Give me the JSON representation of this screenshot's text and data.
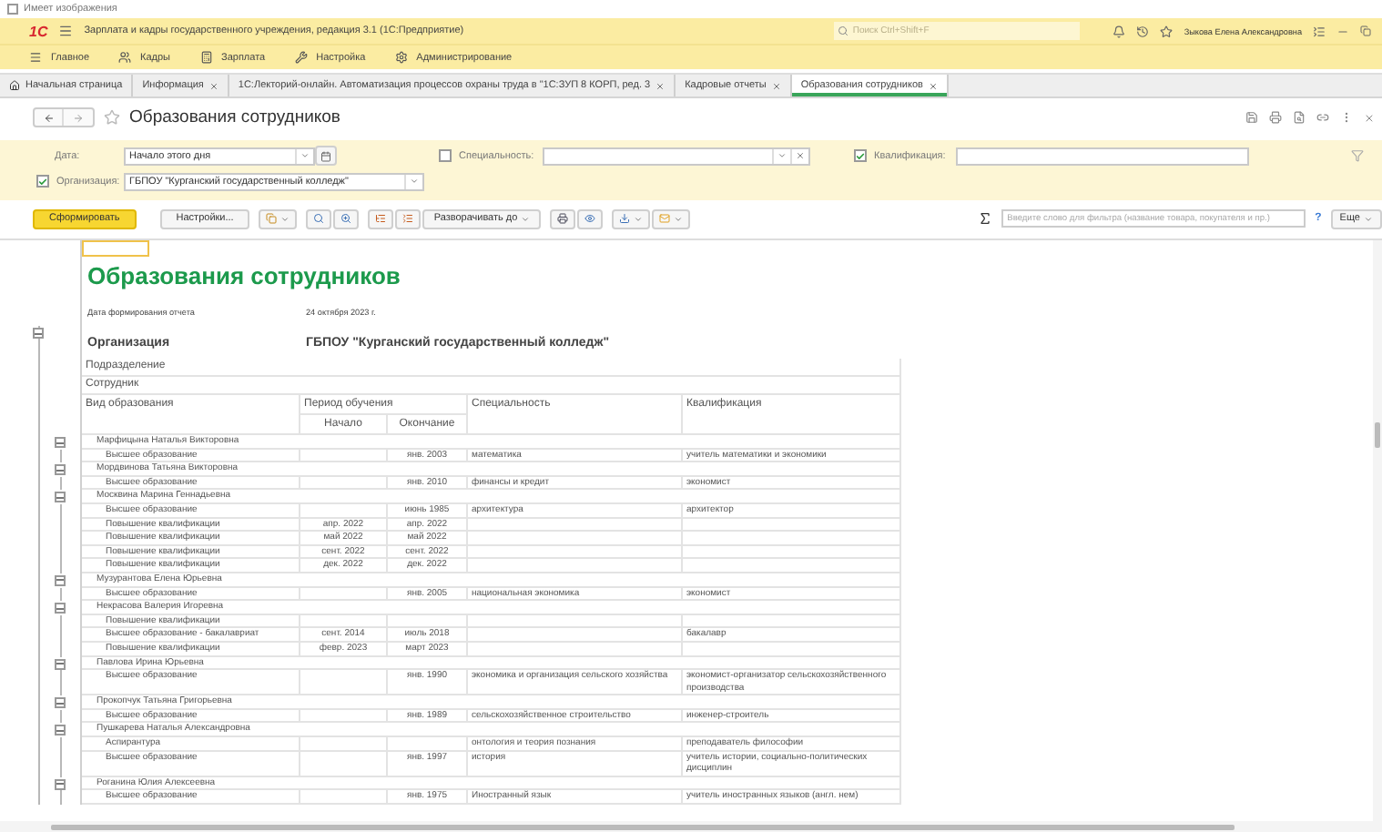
{
  "top_checkbox": {
    "label": "Имеет изображения",
    "checked": false
  },
  "app_bar": {
    "logo": "1С",
    "title": "Зарплата и кадры государственного учреждения, редакция 3.1  (1С:Предприятие)",
    "search": {
      "placeholder": "Поиск Ctrl+Shift+F"
    },
    "user": "Зыкова Елена Александровна"
  },
  "sections": [
    "Главное",
    "Кадры",
    "Зарплата",
    "Настройка",
    "Администрирование"
  ],
  "tabs": [
    {
      "label": "Начальная страница",
      "home": true,
      "closable": false,
      "selected": false
    },
    {
      "label": "Информация",
      "home": false,
      "closable": true,
      "selected": false
    },
    {
      "label": "1С:Лекторий-онлайн. Автоматизация процессов охраны труда в \"1С:ЗУП 8 КОРП, ред. 3",
      "home": false,
      "closable": true,
      "selected": false
    },
    {
      "label": "Кадровые отчеты",
      "home": false,
      "closable": true,
      "selected": false
    },
    {
      "label": "Образования сотрудников",
      "home": false,
      "closable": true,
      "selected": true
    }
  ],
  "form": {
    "title": "Образования сотрудников"
  },
  "filters": {
    "date": {
      "label": "Дата:",
      "value": "Начало этого дня"
    },
    "specialty": {
      "label": "Специальность:",
      "checked": false
    },
    "qualification": {
      "label": "Квалификация:",
      "checked": true
    },
    "organization": {
      "label": "Организация:",
      "checked": true,
      "value": "ГБПОУ \"Курганский государственный колледж\""
    }
  },
  "toolbar": {
    "generate": "Сформировать",
    "settings": "Настройки...",
    "expand": "Разворачивать до",
    "filter_placeholder": "Введите слово для фильтра (название товара, покупателя и пр.)",
    "help": "?",
    "more": "Еще"
  },
  "report": {
    "title": "Образования сотрудников",
    "date_label": "Дата формирования отчета",
    "date": "24 октября 2023 г.",
    "org_label": "Организация",
    "org": "ГБПОУ \"Курганский государственный колледж\"",
    "department_label": "Подразделение",
    "employee_label": "Сотрудник",
    "columns": {
      "type": "Вид образования",
      "period": "Период обучения",
      "start": "Начало",
      "end": "Окончание",
      "specialty": "Специальность",
      "qualification": "Квалификация"
    },
    "rows": [
      {
        "kind": "person",
        "name": "Марфицына Наталья Викторовна",
        "expanded": true
      },
      {
        "kind": "education",
        "type": "Высшее образование",
        "end": "янв. 2003",
        "specialty": "математика",
        "qualification": "учитель математики и экономики"
      },
      {
        "kind": "person",
        "name": "Мордвинова Татьяна Викторовна",
        "expanded": true
      },
      {
        "kind": "education",
        "type": "Высшее образование",
        "end": "янв. 2010",
        "specialty": "финансы и кредит",
        "qualification": "экономист"
      },
      {
        "kind": "person",
        "name": "Москвина Марина Геннадьевна",
        "expanded": true
      },
      {
        "kind": "education",
        "type": "Высшее образование",
        "end": "июнь 1985",
        "specialty": "архитектура",
        "qualification": "архитектор"
      },
      {
        "kind": "education",
        "type": "Повышение квалификации",
        "start": "апр. 2022",
        "end": "апр. 2022"
      },
      {
        "kind": "education",
        "type": "Повышение квалификации",
        "start": "май 2022",
        "end": "май 2022"
      },
      {
        "kind": "education",
        "type": "Повышение квалификации",
        "start": "сент. 2022",
        "end": "сент. 2022"
      },
      {
        "kind": "education",
        "type": "Повышение квалификации",
        "start": "дек. 2022",
        "end": "дек. 2022"
      },
      {
        "kind": "person",
        "name": "Музурантова Елена Юрьевна",
        "expanded": true
      },
      {
        "kind": "education",
        "type": "Высшее образование",
        "end": "янв. 2005",
        "specialty": "национальная экономика",
        "qualification": "экономист"
      },
      {
        "kind": "person",
        "name": "Некрасова Валерия Игоревна",
        "expanded": true
      },
      {
        "kind": "education",
        "type": "Повышение квалификации"
      },
      {
        "kind": "education",
        "type": "Высшее образование - бакалавриат",
        "start": "сент. 2014",
        "end": "июль 2018",
        "qualification": "бакалавр"
      },
      {
        "kind": "education",
        "type": "Повышение квалификации",
        "start": "февр. 2023",
        "end": "март 2023"
      },
      {
        "kind": "person",
        "name": "Павлова Ирина Юрьевна",
        "expanded": true
      },
      {
        "kind": "education",
        "type": "Высшее образование",
        "end": "янв. 1990",
        "specialty": "экономика и организация сельского хозяйства",
        "qualification": "экономист-организатор сельскохозяйственного производства"
      },
      {
        "kind": "person",
        "name": "Прокопчук Татьяна Григорьевна",
        "expanded": true
      },
      {
        "kind": "education",
        "type": "Высшее образование",
        "end": "янв. 1989",
        "specialty": "сельскохозяйственное строительство",
        "qualification": "инженер-строитель"
      },
      {
        "kind": "person",
        "name": "Пушкарева Наталья Александровна",
        "expanded": true
      },
      {
        "kind": "education",
        "type": "Аспирантура",
        "specialty": "онтология и теория познания",
        "qualification": "преподаватель философии"
      },
      {
        "kind": "education",
        "type": "Высшее образование",
        "end": "янв. 1997",
        "specialty": "история",
        "qualification": "учитель истории, социально-политических дисциплин"
      },
      {
        "kind": "person",
        "name": "Роганина Юлия Алексеевна",
        "expanded": true
      },
      {
        "kind": "education",
        "type": "Высшее образование",
        "end": "янв. 1975",
        "specialty": "Иностранный язык",
        "qualification": "учитель иностранных языков (англ. нем)"
      }
    ]
  }
}
